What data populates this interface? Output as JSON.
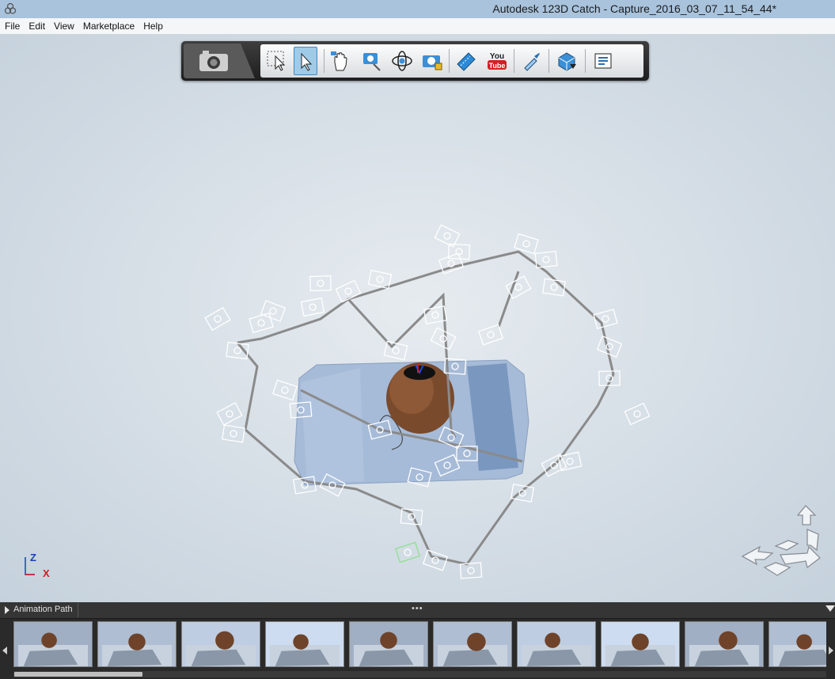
{
  "window": {
    "title": "Autodesk 123D Catch - Capture_2016_03_07_11_54_44*",
    "app_icon": "autodesk-logo-icon"
  },
  "menu": [
    "File",
    "Edit",
    "View",
    "Marketplace",
    "Help"
  ],
  "toolbar": {
    "capture_icon": "camera-icon",
    "tools": [
      {
        "icon": "rectangle-select-icon",
        "active": false
      },
      {
        "icon": "lasso-select-icon",
        "active": true
      },
      {
        "icon": "pan-hand-icon",
        "active": false
      },
      {
        "icon": "zoom-icon",
        "active": false
      },
      {
        "icon": "orbit-icon",
        "active": false
      },
      {
        "icon": "camera-lock-icon",
        "active": false
      },
      {
        "icon": "film-strip-icon",
        "active": false
      },
      {
        "icon": "youtube-icon",
        "active": false
      },
      {
        "icon": "eyedropper-icon",
        "active": false
      },
      {
        "icon": "mesh-export-icon",
        "active": false
      },
      {
        "icon": "properties-icon",
        "active": false
      }
    ],
    "youtube_you": "You",
    "youtube_tube": "Tube"
  },
  "axis": {
    "z": "Z",
    "x": "X",
    "z_color": "#1a3fb8",
    "x_color": "#d21e1e"
  },
  "nav_cube_icon": "navigation-arrows-icon",
  "panel": {
    "title": "Animation Path",
    "grip": "•••"
  },
  "thumbnail_count": 10,
  "colors": {
    "toolbar_bg": "#2a2a2a",
    "active_tool": "#9fcbe8",
    "viewport": "#d9e1e8",
    "panel_bg": "#2a2a2a"
  }
}
